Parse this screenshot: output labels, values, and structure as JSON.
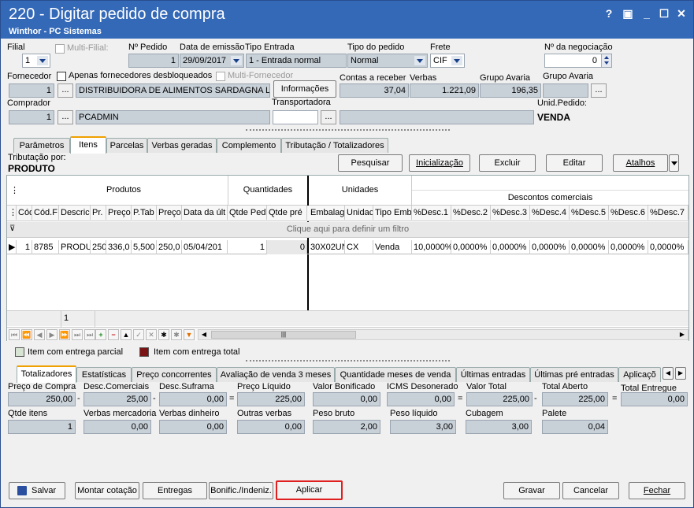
{
  "window": {
    "title": "220 - Digitar pedido de compra",
    "subtitle": "Winthor - PC Sistemas",
    "help": "?",
    "restore": "▣",
    "minimize": "_",
    "maximize": "☐",
    "close": "✕"
  },
  "header": {
    "filial_label": "Filial",
    "filial_value": "1",
    "multifilial_label": "Multi-Filial:",
    "npedido_label": "Nº Pedido",
    "npedido_value": "1",
    "data_emissao_label": "Data de emissão",
    "data_emissao_value": "29/09/2017",
    "tipo_entrada_label": "Tipo Entrada",
    "tipo_entrada_value": "1 - Entrada normal",
    "tipo_pedido_label": "Tipo do pedido",
    "tipo_pedido_value": "Normal",
    "frete_label": "Frete",
    "frete_value": "CIF",
    "nnegociacao_label": "Nº da negociação",
    "nnegociacao_value": "0",
    "fornecedor_label": "Fornecedor",
    "fornecedor_code": "1",
    "fornecedor_name": "DISTRIBUIDORA DE ALIMENTOS SARDAGNA LTDA",
    "apenas_desbloq_label": "Apenas fornecedores desbloqueados",
    "multifornecedor_label": "Multi-Fornecedor",
    "informacoes_label": "Informações",
    "contas_receber_label": "Contas a receber",
    "contas_receber_value": "37,04",
    "verbas_label": "Verbas",
    "verbas_value": "1.221,09",
    "grupo_avaria1_label": "Grupo Avaria",
    "grupo_avaria1_value": "196,35",
    "grupo_avaria2_label": "Grupo Avaria",
    "comprador_label": "Comprador",
    "comprador_code": "1",
    "comprador_name": "PCADMIN",
    "transportadora_label": "Transportadora",
    "unid_pedido_label": "Unid.Pedido:",
    "unid_pedido_value": "VENDA",
    "ellipsis": "..."
  },
  "tabs_top": [
    "Parâmetros",
    "Itens",
    "Parcelas",
    "Verbas geradas",
    "Complemento",
    "Tributação / Totalizadores"
  ],
  "itens": {
    "tributacao_label": "Tributação por:",
    "tributacao_value": "PRODUTO",
    "pesquisar": "Pesquisar",
    "inicializacao": "Inicialização",
    "excluir": "Excluir",
    "editar": "Editar",
    "atalhos": "Atalhos",
    "groups": {
      "produtos": "Produtos",
      "quantidades": "Quantidades",
      "unidades": "Unidades",
      "descontos": "Descontos comerciais"
    },
    "columns": [
      "Cód",
      "Cód.F",
      "Descric",
      "Pr.",
      "Preço",
      "P.Tab",
      "Preço",
      "Data da últ",
      "Qtde Ped",
      "Qtde pré",
      "Embalage",
      "Unidac",
      "Tipo Emb",
      "%Desc.1",
      "%Desc.2",
      "%Desc.3",
      "%Desc.4",
      "%Desc.5",
      "%Desc.6",
      "%Desc.7"
    ],
    "filter_text": "Clique aqui para definir um filtro",
    "row": [
      "1",
      "8785",
      "PRODU",
      "250",
      "336,0",
      "5,500",
      "250,0",
      "05/04/201",
      "1",
      "0",
      "30X02UN",
      "CX",
      "Venda",
      "10,0000%",
      "0,0000%",
      "0,0000%",
      "0,0000%",
      "0,0000%",
      "0,0000%",
      "0,0000%"
    ],
    "footer_count": "1"
  },
  "legend": {
    "parcial": "Item com entrega parcial",
    "total": "Item com entrega total",
    "parcial_color": "#d7e4d3",
    "total_color": "#7a1414"
  },
  "tabs_bottom": [
    "Totalizadores",
    "Estatísticas",
    "Preço concorrentes",
    "Avaliação de venda 3 meses",
    "Quantidade meses de venda",
    "Últimas entradas",
    "Últimas pré entradas",
    "Aplicaçõ"
  ],
  "totals": {
    "preco_compra_label": "Preço de Compra",
    "preco_compra": "250,00",
    "desc_comerciais_label": "Desc.Comerciais",
    "desc_comerciais": "25,00",
    "desc_suframa_label": "Desc.Suframa",
    "desc_suframa": "0,00",
    "preco_liquido_label": "Preço Líquido",
    "preco_liquido": "225,00",
    "valor_bonificado_label": "Valor Bonificado",
    "valor_bonificado": "0,00",
    "icms_desonerado_label": "ICMS Desonerado",
    "icms_desonerado": "0,00",
    "valor_total_label": "Valor Total",
    "valor_total": "225,00",
    "total_aberto_label": "Total Aberto",
    "total_aberto": "225,00",
    "total_entregue_label": "Total Entregue",
    "total_entregue": "0,00",
    "qtde_itens_label": "Qtde itens",
    "qtde_itens": "1",
    "verbas_mercadoria_label": "Verbas mercadoria",
    "verbas_mercadoria": "0,00",
    "verbas_dinheiro_label": "Verbas dinheiro",
    "verbas_dinheiro": "0,00",
    "outras_verbas_label": "Outras verbas",
    "outras_verbas": "0,00",
    "peso_bruto_label": "Peso bruto",
    "peso_bruto": "2,00",
    "peso_liquido_label": "Peso líquido",
    "peso_liquido": "3,00",
    "cubagem_label": "Cubagem",
    "cubagem": "3,00",
    "palete_label": "Palete",
    "palete": "0,04",
    "minus": "-",
    "equals": "="
  },
  "footer": {
    "salvar": "Salvar",
    "montar_cotacao": "Montar cotação",
    "entregas": "Entregas",
    "bonific": "Bonific./Indeniz.",
    "aplicar": "Aplicar",
    "gravar": "Gravar",
    "cancelar": "Cancelar",
    "fechar": "Fechar"
  },
  "colors": {
    "titlebar": "#3469b8",
    "highlight": "#e02020",
    "tab_accent": "#f0a000"
  }
}
